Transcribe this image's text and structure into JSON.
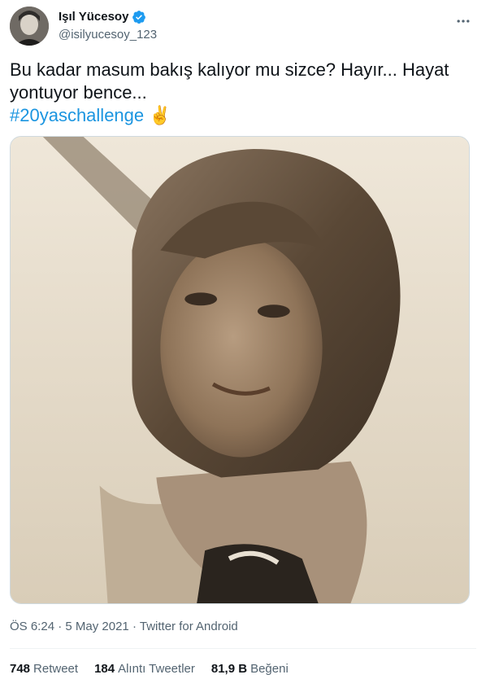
{
  "author": {
    "display_name": "Işıl Yücesoy",
    "handle": "@isilyucesoy_123",
    "verified": true
  },
  "tweet": {
    "text": "Bu kadar masum bakış kalıyor mu sizce? Hayır... Hayat yontuyor bence...",
    "hashtag": "#20yaschallenge",
    "emoji": "✌️"
  },
  "meta": {
    "time": "ÖS 6:24",
    "separator": "·",
    "date": "5 May 2021",
    "source": "Twitter for Android"
  },
  "stats": [
    {
      "count": "748",
      "label": "Retweet"
    },
    {
      "count": "184",
      "label": "Alıntı Tweetler"
    },
    {
      "count": "81,9 B",
      "label": "Beğeni"
    }
  ],
  "colors": {
    "accent": "#1b95e0",
    "verified": "#1d9bf0",
    "secondary_text": "#536471",
    "border": "#cfd9de"
  },
  "icons": {
    "more": "more-horizontal-icon",
    "verified": "verified-badge-icon"
  }
}
